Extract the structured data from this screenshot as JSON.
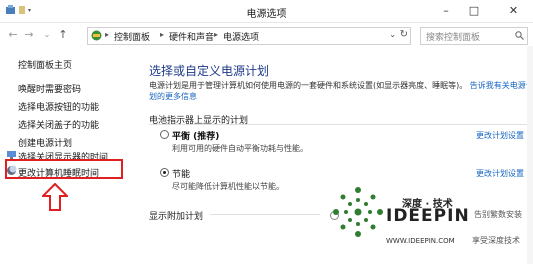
{
  "window": {
    "title": "电源选项"
  },
  "address": {
    "crumbs": [
      "控制面板",
      "硬件和声音",
      "电源选项"
    ],
    "search_placeholder": "搜索控制面板"
  },
  "sidebar": {
    "home": "控制面板主页",
    "items": [
      "唤醒时需要密码",
      "选择电源按钮的功能",
      "选择关闭盖子的功能",
      "创建电源计划",
      "选择关闭显示器的时间",
      "更改计算机睡眠时间"
    ]
  },
  "main": {
    "heading": "选择或自定义电源计划",
    "desc_line1": "电源计划是用于管理计算机如何使用电源的一套硬件和系统设置(如显示器亮度、睡眠等)。",
    "desc_link": "告诉我有关电源计",
    "desc_line2": "划的更多信息",
    "section_label": "电池指示器上显示的计划",
    "plans": [
      {
        "name": "平衡 (推荐)",
        "desc": "利用可用的硬件自动平衡功耗与性能。",
        "link": "更改计划设置",
        "selected": false
      },
      {
        "name": "节能",
        "desc": "尽可能降低计算机性能以节能。",
        "link": "更改计划设置",
        "selected": true
      }
    ],
    "more_plans_label": "显示附加计划",
    "more_plans_side": "告别繁数安装"
  },
  "watermark": {
    "cn": "深度 · 技术",
    "brand": "IDEEPIN",
    "url": "WWW.IDEEPIN.COM",
    "slogan": "享受深度技术"
  },
  "colors": {
    "accent": "#1565c0",
    "heading": "#1e3a8a",
    "highlight": "#e02020",
    "logo": "#2e7d32"
  }
}
